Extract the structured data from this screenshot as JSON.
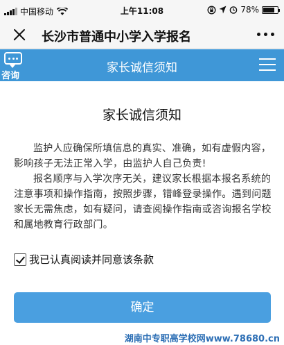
{
  "status_bar": {
    "carrier": "中国移动",
    "time": "上午11:08",
    "battery": "78%",
    "battery_level": 0.78,
    "icons": [
      "signal-icon",
      "wifi-icon",
      "lock-rotation-icon",
      "location-icon",
      "alarm-icon",
      "battery-icon"
    ]
  },
  "nav": {
    "title": "长沙市普通中小学入学报名",
    "close_icon": "close-icon",
    "more_icon": "more-icon"
  },
  "header": {
    "consult_label": "咨询",
    "title": "家长诚信须知",
    "accent_color": "#3f97d7"
  },
  "notice": {
    "title": "家长诚信须知",
    "paragraph1": "监护人应确保所填信息的真实、准确，如有虚假内容，影响孩子无法正常入学，由监护人自己负责!",
    "paragraph2": "报名顺序与入学次序无关，建议家长根据本报名系统的注意事项和操作指南，按照步骤，错峰登录操作。遇到问题家长无需焦虑，如有疑问，请查阅操作指南或咨询报名学校和属地教育行政部门。"
  },
  "agreement": {
    "checked": true,
    "label": "我已认真阅读并同意该条款"
  },
  "confirm_button": {
    "label": "确定",
    "color": "#4a9fe0"
  },
  "watermark": "湖南中专职高学校网www.78680.cn"
}
